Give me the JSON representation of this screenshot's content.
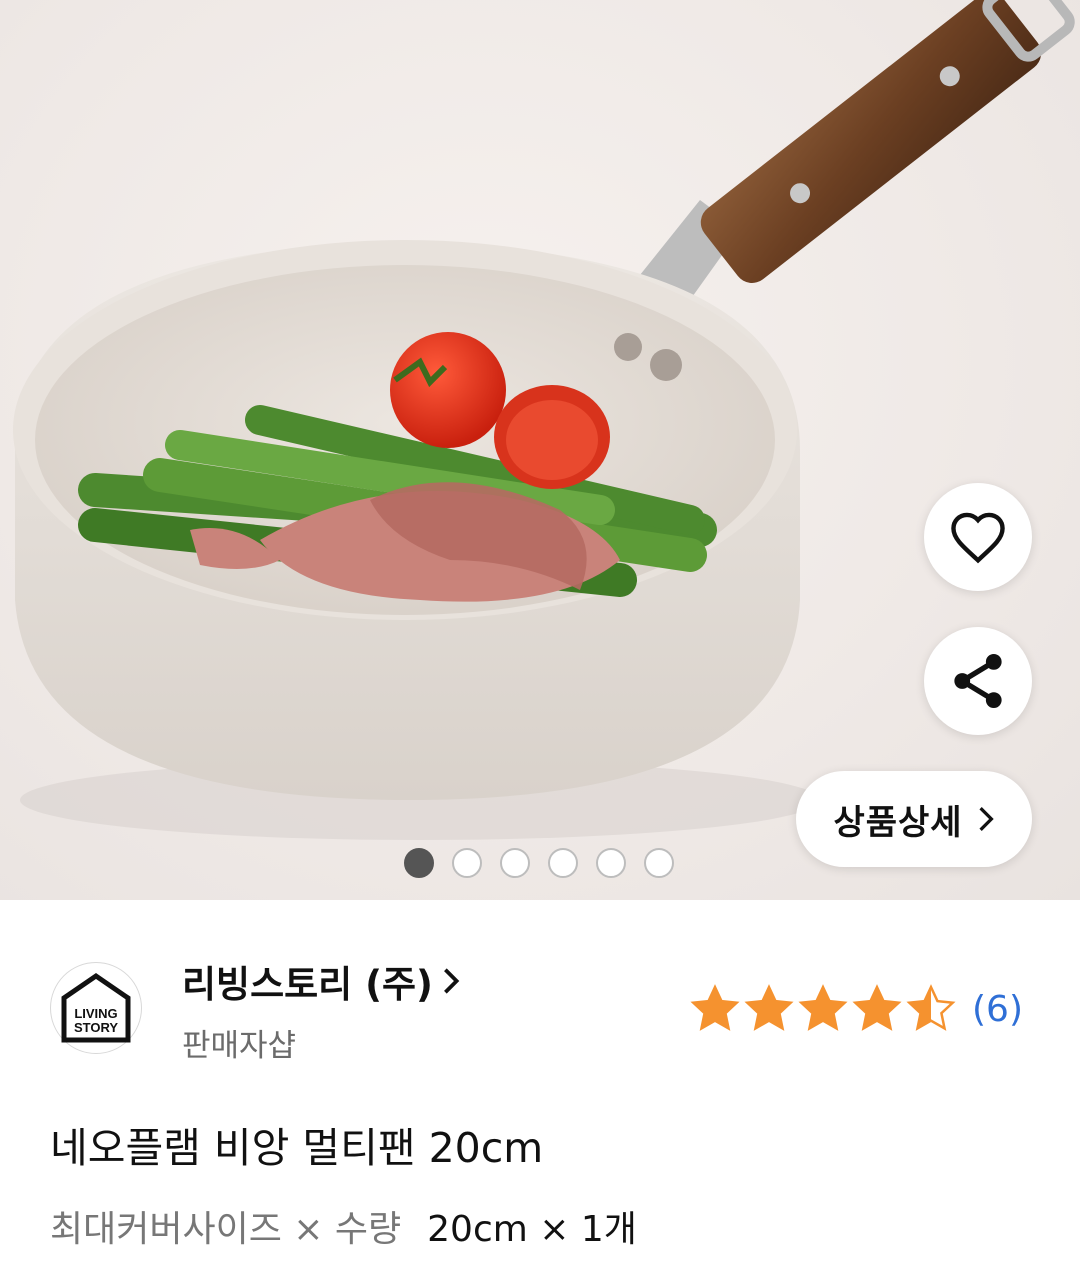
{
  "hero": {
    "image_alt": "",
    "actions": {
      "like_icon": "heart-outline-icon",
      "share_icon": "share-icon"
    },
    "detail_button": {
      "label": "상품상세",
      "icon": "chevron-right-icon"
    },
    "pagination": {
      "total": 6,
      "current": 1
    }
  },
  "seller": {
    "logo_text_line1": "LIVING",
    "logo_text_line2": "STORY",
    "name": "리빙스토리 (주)",
    "subtitle": "판매자샵"
  },
  "rating": {
    "value": 4.5,
    "max": 5,
    "count_label": "(6)",
    "color": "#f5922f"
  },
  "product": {
    "title": "네오플램 비앙 멀티팬 20cm",
    "option_label": "최대커버사이즈 × 수량",
    "option_value": "20cm × 1개"
  },
  "colors": {
    "accent_blue": "#2f6fd6",
    "star_orange": "#f5922f"
  }
}
